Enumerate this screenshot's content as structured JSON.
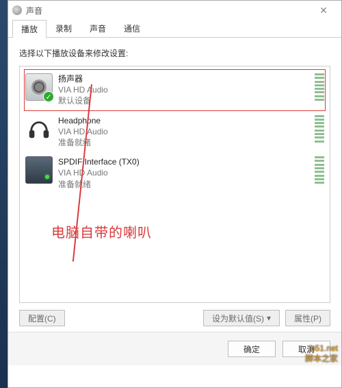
{
  "title": "声音",
  "tabs": [
    "播放",
    "录制",
    "声音",
    "通信"
  ],
  "activeTab": 0,
  "instruction": "选择以下播放设备来修改设置:",
  "devices": [
    {
      "name": "扬声器",
      "sub": "VIA HD Audio",
      "status": "默认设备",
      "iconType": "speaker",
      "isDefault": true,
      "highlighted": true
    },
    {
      "name": "Headphone",
      "sub": "VIA HD Audio",
      "status": "准备就绪",
      "iconType": "headphone",
      "isDefault": false,
      "highlighted": false
    },
    {
      "name": "SPDIF Interface (TX0)",
      "sub": "VIA HD Audio",
      "status": "准备就绪",
      "iconType": "spdif",
      "isDefault": false,
      "highlighted": false
    }
  ],
  "annotation": "电脑自带的喇叭",
  "annotationColor": "#d93a3a",
  "buttons": {
    "configure": "配置(C)",
    "setDefault": "设为默认值(S)",
    "properties": "属性(P)",
    "ok": "确定",
    "cancel": "取消"
  },
  "watermark": {
    "line1": "jb51.net",
    "line2": "脚本之家"
  }
}
